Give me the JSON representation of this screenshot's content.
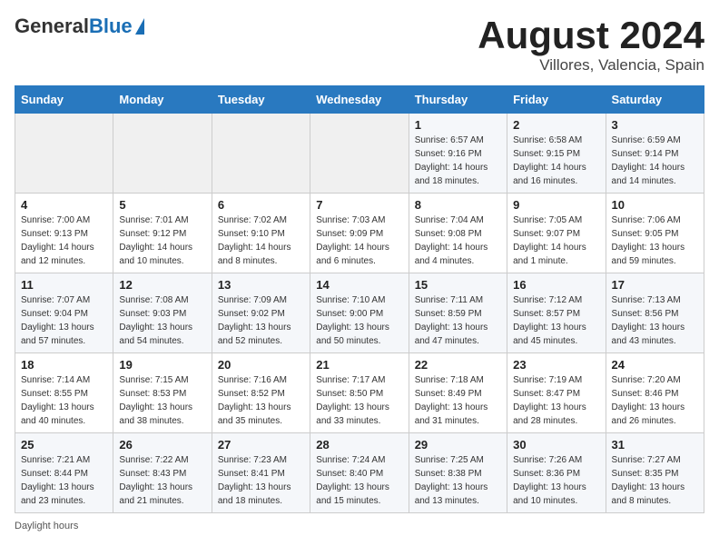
{
  "header": {
    "logo_general": "General",
    "logo_blue": "Blue",
    "title": "August 2024",
    "subtitle": "Villores, Valencia, Spain"
  },
  "calendar": {
    "days_of_week": [
      "Sunday",
      "Monday",
      "Tuesday",
      "Wednesday",
      "Thursday",
      "Friday",
      "Saturday"
    ],
    "weeks": [
      [
        {
          "day": "",
          "sunrise": "",
          "sunset": "",
          "daylight": ""
        },
        {
          "day": "",
          "sunrise": "",
          "sunset": "",
          "daylight": ""
        },
        {
          "day": "",
          "sunrise": "",
          "sunset": "",
          "daylight": ""
        },
        {
          "day": "",
          "sunrise": "",
          "sunset": "",
          "daylight": ""
        },
        {
          "day": "1",
          "sunrise": "Sunrise: 6:57 AM",
          "sunset": "Sunset: 9:16 PM",
          "daylight": "Daylight: 14 hours and 18 minutes."
        },
        {
          "day": "2",
          "sunrise": "Sunrise: 6:58 AM",
          "sunset": "Sunset: 9:15 PM",
          "daylight": "Daylight: 14 hours and 16 minutes."
        },
        {
          "day": "3",
          "sunrise": "Sunrise: 6:59 AM",
          "sunset": "Sunset: 9:14 PM",
          "daylight": "Daylight: 14 hours and 14 minutes."
        }
      ],
      [
        {
          "day": "4",
          "sunrise": "Sunrise: 7:00 AM",
          "sunset": "Sunset: 9:13 PM",
          "daylight": "Daylight: 14 hours and 12 minutes."
        },
        {
          "day": "5",
          "sunrise": "Sunrise: 7:01 AM",
          "sunset": "Sunset: 9:12 PM",
          "daylight": "Daylight: 14 hours and 10 minutes."
        },
        {
          "day": "6",
          "sunrise": "Sunrise: 7:02 AM",
          "sunset": "Sunset: 9:10 PM",
          "daylight": "Daylight: 14 hours and 8 minutes."
        },
        {
          "day": "7",
          "sunrise": "Sunrise: 7:03 AM",
          "sunset": "Sunset: 9:09 PM",
          "daylight": "Daylight: 14 hours and 6 minutes."
        },
        {
          "day": "8",
          "sunrise": "Sunrise: 7:04 AM",
          "sunset": "Sunset: 9:08 PM",
          "daylight": "Daylight: 14 hours and 4 minutes."
        },
        {
          "day": "9",
          "sunrise": "Sunrise: 7:05 AM",
          "sunset": "Sunset: 9:07 PM",
          "daylight": "Daylight: 14 hours and 1 minute."
        },
        {
          "day": "10",
          "sunrise": "Sunrise: 7:06 AM",
          "sunset": "Sunset: 9:05 PM",
          "daylight": "Daylight: 13 hours and 59 minutes."
        }
      ],
      [
        {
          "day": "11",
          "sunrise": "Sunrise: 7:07 AM",
          "sunset": "Sunset: 9:04 PM",
          "daylight": "Daylight: 13 hours and 57 minutes."
        },
        {
          "day": "12",
          "sunrise": "Sunrise: 7:08 AM",
          "sunset": "Sunset: 9:03 PM",
          "daylight": "Daylight: 13 hours and 54 minutes."
        },
        {
          "day": "13",
          "sunrise": "Sunrise: 7:09 AM",
          "sunset": "Sunset: 9:02 PM",
          "daylight": "Daylight: 13 hours and 52 minutes."
        },
        {
          "day": "14",
          "sunrise": "Sunrise: 7:10 AM",
          "sunset": "Sunset: 9:00 PM",
          "daylight": "Daylight: 13 hours and 50 minutes."
        },
        {
          "day": "15",
          "sunrise": "Sunrise: 7:11 AM",
          "sunset": "Sunset: 8:59 PM",
          "daylight": "Daylight: 13 hours and 47 minutes."
        },
        {
          "day": "16",
          "sunrise": "Sunrise: 7:12 AM",
          "sunset": "Sunset: 8:57 PM",
          "daylight": "Daylight: 13 hours and 45 minutes."
        },
        {
          "day": "17",
          "sunrise": "Sunrise: 7:13 AM",
          "sunset": "Sunset: 8:56 PM",
          "daylight": "Daylight: 13 hours and 43 minutes."
        }
      ],
      [
        {
          "day": "18",
          "sunrise": "Sunrise: 7:14 AM",
          "sunset": "Sunset: 8:55 PM",
          "daylight": "Daylight: 13 hours and 40 minutes."
        },
        {
          "day": "19",
          "sunrise": "Sunrise: 7:15 AM",
          "sunset": "Sunset: 8:53 PM",
          "daylight": "Daylight: 13 hours and 38 minutes."
        },
        {
          "day": "20",
          "sunrise": "Sunrise: 7:16 AM",
          "sunset": "Sunset: 8:52 PM",
          "daylight": "Daylight: 13 hours and 35 minutes."
        },
        {
          "day": "21",
          "sunrise": "Sunrise: 7:17 AM",
          "sunset": "Sunset: 8:50 PM",
          "daylight": "Daylight: 13 hours and 33 minutes."
        },
        {
          "day": "22",
          "sunrise": "Sunrise: 7:18 AM",
          "sunset": "Sunset: 8:49 PM",
          "daylight": "Daylight: 13 hours and 31 minutes."
        },
        {
          "day": "23",
          "sunrise": "Sunrise: 7:19 AM",
          "sunset": "Sunset: 8:47 PM",
          "daylight": "Daylight: 13 hours and 28 minutes."
        },
        {
          "day": "24",
          "sunrise": "Sunrise: 7:20 AM",
          "sunset": "Sunset: 8:46 PM",
          "daylight": "Daylight: 13 hours and 26 minutes."
        }
      ],
      [
        {
          "day": "25",
          "sunrise": "Sunrise: 7:21 AM",
          "sunset": "Sunset: 8:44 PM",
          "daylight": "Daylight: 13 hours and 23 minutes."
        },
        {
          "day": "26",
          "sunrise": "Sunrise: 7:22 AM",
          "sunset": "Sunset: 8:43 PM",
          "daylight": "Daylight: 13 hours and 21 minutes."
        },
        {
          "day": "27",
          "sunrise": "Sunrise: 7:23 AM",
          "sunset": "Sunset: 8:41 PM",
          "daylight": "Daylight: 13 hours and 18 minutes."
        },
        {
          "day": "28",
          "sunrise": "Sunrise: 7:24 AM",
          "sunset": "Sunset: 8:40 PM",
          "daylight": "Daylight: 13 hours and 15 minutes."
        },
        {
          "day": "29",
          "sunrise": "Sunrise: 7:25 AM",
          "sunset": "Sunset: 8:38 PM",
          "daylight": "Daylight: 13 hours and 13 minutes."
        },
        {
          "day": "30",
          "sunrise": "Sunrise: 7:26 AM",
          "sunset": "Sunset: 8:36 PM",
          "daylight": "Daylight: 13 hours and 10 minutes."
        },
        {
          "day": "31",
          "sunrise": "Sunrise: 7:27 AM",
          "sunset": "Sunset: 8:35 PM",
          "daylight": "Daylight: 13 hours and 8 minutes."
        }
      ]
    ]
  },
  "footer": {
    "note": "Daylight hours"
  }
}
